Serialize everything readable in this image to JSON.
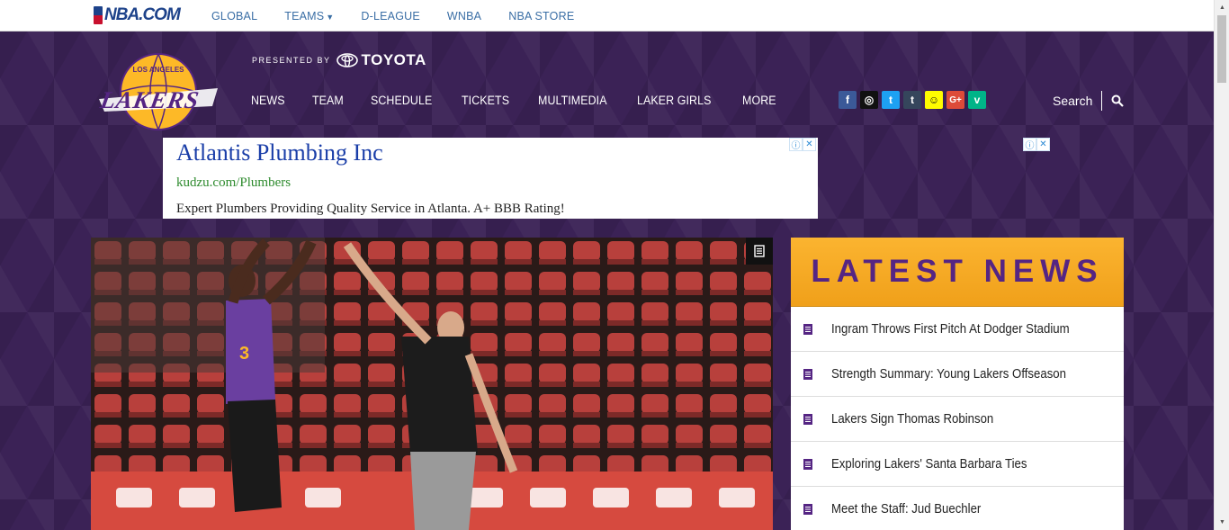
{
  "nba_bar": {
    "logo": "NBA.COM",
    "links": [
      "GLOBAL",
      "TEAMS",
      "D-LEAGUE",
      "WNBA",
      "NBA STORE"
    ]
  },
  "sponsor": {
    "presented_by": "PRESENTED BY",
    "brand": "TOYOTA"
  },
  "main_nav": [
    "NEWS",
    "TEAM",
    "SCHEDULE",
    "TICKETS",
    "MULTIMEDIA",
    "LAKER GIRLS",
    "MORE"
  ],
  "social": [
    {
      "icon": "facebook-icon",
      "glyph": "f",
      "color": "#3b5998"
    },
    {
      "icon": "instagram-icon",
      "glyph": "◎",
      "color": "#111111"
    },
    {
      "icon": "twitter-icon",
      "glyph": "t",
      "color": "#1da1f2"
    },
    {
      "icon": "tumblr-icon",
      "glyph": "t",
      "color": "#35465c"
    },
    {
      "icon": "snapchat-icon",
      "glyph": "☺",
      "color": "#fffc00"
    },
    {
      "icon": "google-plus-icon",
      "glyph": "G+",
      "color": "#dd4b39"
    },
    {
      "icon": "vine-icon",
      "glyph": "v",
      "color": "#00b488"
    }
  ],
  "search": {
    "label": "Search"
  },
  "ad": {
    "headline": "Atlantis Plumbing Inc",
    "url": "kudzu.com/Plumbers",
    "description": "Expert Plumbers Providing Quality Service in Atlanta. A+ BBB Rating!"
  },
  "latest_news": {
    "heading": "LATEST NEWS",
    "items": [
      "Ingram Throws First Pitch At Dodger Stadium",
      "Strength Summary: Young Lakers Offseason",
      "Lakers Sign Thomas Robinson",
      "Exploring Lakers' Santa Barbara Ties",
      "Meet the Staff: Jud Buechler"
    ]
  },
  "colors": {
    "lakers_purple": "#552583",
    "lakers_gold": "#fdb927",
    "header_bg": "#3b2256"
  }
}
